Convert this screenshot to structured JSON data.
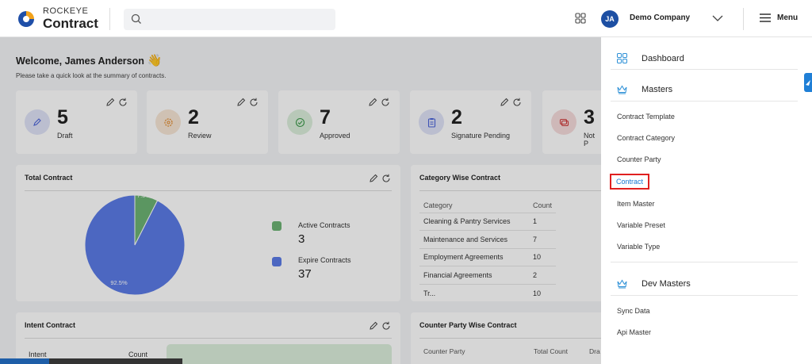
{
  "brand": {
    "top": "ROCKEYE",
    "bottom": "Contract"
  },
  "header": {
    "search_placeholder": "",
    "avatar": "JA",
    "company": "Demo Company",
    "menu_label": "Menu"
  },
  "welcome": {
    "title": "Welcome, James Anderson",
    "subtitle": "Please take a quick look at the summary of contracts."
  },
  "stats": [
    {
      "value": "5",
      "label": "Draft"
    },
    {
      "value": "2",
      "label": "Review"
    },
    {
      "value": "7",
      "label": "Approved"
    },
    {
      "value": "2",
      "label": "Signature Pending"
    },
    {
      "value": "3",
      "label": "Not P"
    }
  ],
  "total_contract": {
    "title": "Total Contract",
    "legend": [
      {
        "label": "Active Contracts",
        "value": "3",
        "color": "#6db374"
      },
      {
        "label": "Expire Contracts",
        "value": "37",
        "color": "#5b7be6"
      }
    ]
  },
  "chart_data": {
    "type": "pie",
    "title": "Total Contract",
    "labels": [
      "Active Contracts",
      "Expire Contracts"
    ],
    "values": [
      3,
      37
    ],
    "percent_labels": [
      "7.5%",
      "92.5%"
    ],
    "colors": [
      "#6db374",
      "#5b7be6"
    ],
    "legend_position": "right"
  },
  "category": {
    "title": "Category Wise Contract",
    "columns": [
      "Category",
      "Count"
    ],
    "rows": [
      [
        "Cleaning & Pantry Services",
        "1"
      ],
      [
        "Maintenance and Services",
        "7"
      ],
      [
        "Employment Agreements",
        "10"
      ],
      [
        "Financial Agreements",
        "2"
      ],
      [
        "Tr...",
        "10"
      ]
    ]
  },
  "intent": {
    "title": "Intent Contract",
    "columns": [
      "Intent",
      "Count"
    ]
  },
  "counter_party": {
    "title": "Counter Party Wise Contract",
    "columns": [
      "Counter Party",
      "Total Count",
      "Dra"
    ]
  },
  "side_menu": {
    "sections": [
      {
        "label": "Dashboard"
      },
      {
        "label": "Masters"
      },
      {
        "label": "Dev Masters"
      }
    ],
    "masters_items": [
      "Contract Template",
      "Contract Category",
      "Counter Party",
      "Contract",
      "Item Master",
      "Variable Preset",
      "Variable Type"
    ],
    "dev_items": [
      "Sync Data",
      "Api Master"
    ],
    "active_item": "Contract"
  }
}
